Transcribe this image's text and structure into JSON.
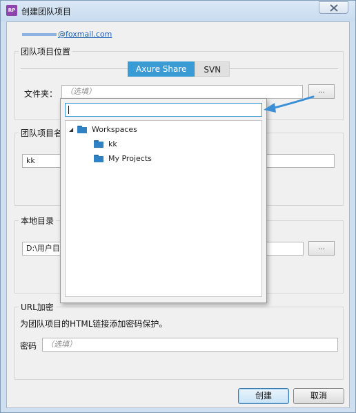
{
  "window": {
    "app_icon_text": "RP",
    "title": "创建团队项目"
  },
  "account": {
    "email_visible": "@foxmail.com"
  },
  "location_group": {
    "legend": "团队项目位置",
    "tabs": [
      {
        "label": "Axure Share",
        "active": true
      },
      {
        "label": "SVN",
        "active": false
      }
    ],
    "folder_label": "文件夹：",
    "folder_placeholder": "（选填）",
    "browse_label": "..."
  },
  "name_group": {
    "legend": "团队项目名",
    "value": "kk"
  },
  "local_group": {
    "legend": "本地目录",
    "value": "D:\\用户目录",
    "browse_label": "..."
  },
  "url_group": {
    "legend": "URL加密",
    "description": "为团队项目的HTML链接添加密码保护。",
    "password_label": "密码",
    "password_placeholder": "（选填）"
  },
  "buttons": {
    "create": "创建",
    "cancel": "取消"
  },
  "folder_popup": {
    "search_value": "",
    "tree": [
      {
        "label": "Workspaces",
        "level": 0,
        "expanded": true,
        "icon": "folder-icon"
      },
      {
        "label": "kk",
        "level": 1,
        "icon": "folder-icon"
      },
      {
        "label": "My Projects",
        "level": 1,
        "icon": "folder-icon"
      }
    ]
  },
  "colors": {
    "accent": "#3a9bd5",
    "folder": "#2f83c4",
    "link": "#1a5fb4",
    "annotation_arrow": "#3a8fd6"
  }
}
